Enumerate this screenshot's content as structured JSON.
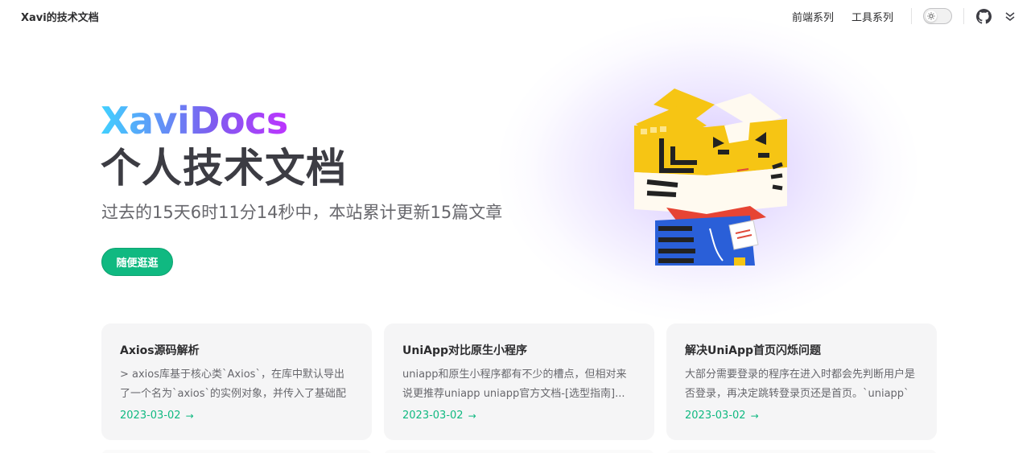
{
  "nav": {
    "brand": "Xavi的技术文档",
    "links": [
      "前端系列",
      "工具系列"
    ]
  },
  "hero": {
    "name": "XaviDocs",
    "text": "个人技术文档",
    "tagline": "过去的15天6时11分14秒中，本站累计更新15篇文章",
    "action": "随便逛逛"
  },
  "features": [
    {
      "title": "Axios源码解析",
      "desc": "> axios库基于核心类`Axios`，在库中默认导出了一个名为`axios`的实例对象，并传入了基础配置...",
      "date": "2023-03-02"
    },
    {
      "title": "UniApp对比原生小程序",
      "desc": "uniapp和原生小程序都有不少的槽点，但相对来说更推荐uniapp uniapp官方文档-[选型指南]...",
      "date": "2023-03-02"
    },
    {
      "title": "解决UniApp首页闪烁问题",
      "desc": "大部分需要登录的程序在进入时都会先判断用户是否登录，再决定跳转登录页还是首页。`uniapp`将...",
      "date": "2023-03-02"
    }
  ],
  "colors": {
    "brand_green": "#10b981",
    "name_gradient_start": "#41d1ff",
    "name_gradient_end": "#bd34fe"
  },
  "icons": [
    "sun-icon",
    "github-icon",
    "chevron-double-down-icon",
    "arrow-right-icon"
  ]
}
